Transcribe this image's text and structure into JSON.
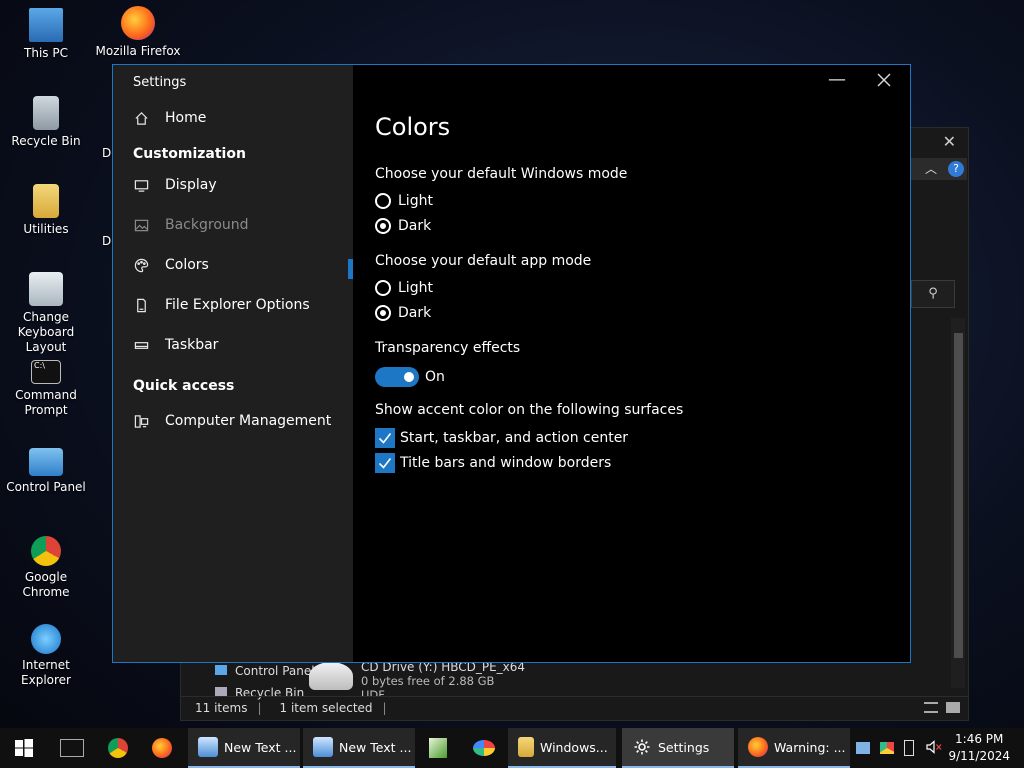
{
  "desktop": {
    "icons": [
      {
        "label": "This PC"
      },
      {
        "label": "Mozilla Firefox"
      },
      {
        "label": "Recycle Bin"
      },
      {
        "label": "Utilities"
      },
      {
        "label": "Change Keyboard Layout"
      },
      {
        "label": "Command Prompt"
      },
      {
        "label": "Control Panel"
      },
      {
        "label": "Google Chrome"
      },
      {
        "label": "Internet Explorer"
      }
    ],
    "partial_labels": [
      "De",
      "De"
    ]
  },
  "explorer": {
    "close": "✕",
    "help": "?",
    "search_icon": "⚲",
    "tree_items": [
      "Control Panel",
      "Recycle Bin"
    ],
    "drive_name": "CD Drive (Y:) HBCD_PE_x64",
    "drive_free": "0 bytes free of 2.88 GB",
    "drive_fs": "UDF",
    "status_items": "11 items",
    "status_selected": "1 item selected"
  },
  "settings": {
    "window_title": "Settings",
    "nav": {
      "home": "Home",
      "customization_header": "Customization",
      "display": "Display",
      "background": "Background",
      "colors": "Colors",
      "file_explorer_options": "File Explorer Options",
      "taskbar": "Taskbar",
      "quick_access_header": "Quick access",
      "computer_management": "Computer Management"
    },
    "page_title": "Colors",
    "windows_mode": {
      "label": "Choose your default Windows mode",
      "options": [
        "Light",
        "Dark"
      ],
      "selected": "Dark"
    },
    "app_mode": {
      "label": "Choose your default app mode",
      "options": [
        "Light",
        "Dark"
      ],
      "selected": "Dark"
    },
    "transparency": {
      "label": "Transparency effects",
      "state": "On"
    },
    "accent": {
      "label": "Show accent color on the following surfaces",
      "options": [
        {
          "label": "Start, taskbar, and action center",
          "checked": true
        },
        {
          "label": "Title bars and window borders",
          "checked": true
        }
      ]
    },
    "accent_color": "#1d77c4"
  },
  "taskbar": {
    "tasks": [
      {
        "label": "New Text ..."
      },
      {
        "label": "New Text ..."
      },
      {
        "label": "Windows..."
      },
      {
        "label": "Settings"
      },
      {
        "label": "Warning: ..."
      }
    ],
    "clock_time": "1:46 PM",
    "clock_date": "9/11/2024"
  }
}
